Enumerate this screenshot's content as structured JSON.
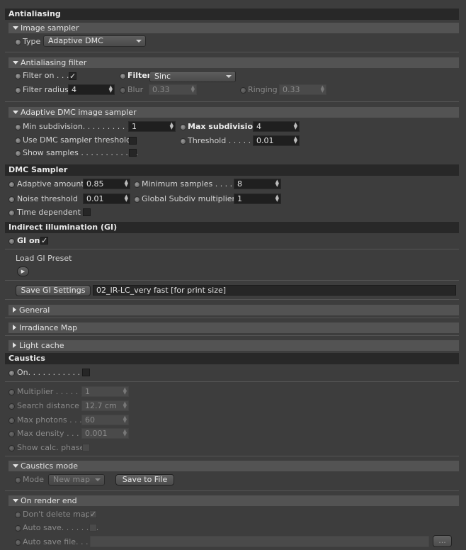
{
  "sections": {
    "antialiasing": "Antialiasing",
    "dmc_sampler": "DMC Sampler",
    "indirect_illumination": "Indirect illumination (GI)",
    "caustics": "Caustics"
  },
  "image_sampler": {
    "title": "Image sampler",
    "type_label": "Type",
    "type_value": "Adaptive DMC"
  },
  "aa_filter": {
    "title": "Antialiasing filter",
    "filter_on_label": "Filter on . . .",
    "filter_on_checked": "✓",
    "filter_label": "Filter",
    "filter_value": "Sinc",
    "filter_radius_label": "Filter radius",
    "filter_radius_value": "4",
    "blur_label": "Blur",
    "blur_value": "0.33",
    "ringing_label": "Ringing",
    "ringing_value": "0.33"
  },
  "adaptive_dmc": {
    "title": "Adaptive DMC image sampler",
    "min_subdiv_label": "Min subdivision. . . . . . . . . . .",
    "min_subdiv_value": "1",
    "max_subdiv_label": "Max subdivision",
    "max_subdiv_value": "4",
    "use_dmc_threshold_label": "Use DMC sampler threshold",
    "threshold_label": "Threshold . . . . . .",
    "threshold_value": "0.01",
    "show_samples_label": "Show samples . . . . . . . . . . . ."
  },
  "dmc": {
    "adaptive_amount_label": "Adaptive amount",
    "adaptive_amount_value": "0.85",
    "min_samples_label": "Minimum samples . . . . .",
    "min_samples_value": "8",
    "noise_threshold_label": "Noise threshold",
    "noise_threshold_value": "0.01",
    "global_subdiv_label": "Global Subdiv multiplier",
    "global_subdiv_value": "1",
    "time_dependent_label": "Time dependent"
  },
  "gi": {
    "gi_on_label": "GI on",
    "gi_on_checked": "✓",
    "load_preset_label": "Load GI Preset",
    "save_button": "Save GI Settings",
    "preset_name": "02_IR-LC_very fast [for print size]",
    "general": "General",
    "irradiance_map": "Irradiance Map",
    "light_cache": "Light cache"
  },
  "caustics": {
    "on_label": "On. . . . . . . . . . . .",
    "multiplier_label": "Multiplier . . . . . .",
    "multiplier_value": "1",
    "search_distance_label": "Search distance",
    "search_distance_value": "12.7 cm",
    "max_photons_label": "Max photons . . .",
    "max_photons_value": "60",
    "max_density_label": "Max density . . . .",
    "max_density_value": "0.001",
    "show_calc_label": "Show calc. phase",
    "mode_title": "Caustics mode",
    "mode_label": "Mode",
    "mode_value": "New map",
    "save_to_file": "Save to File",
    "render_end_title": "On render end",
    "dont_delete_label": "Don't delete map",
    "dont_delete_checked": "✓",
    "auto_save_label": "Auto save. . . . . . . .",
    "auto_save_file_label": "Auto save file. . . .",
    "browse_button": "..."
  },
  "colors": {
    "background": "#3d3d3d",
    "header": "#282828",
    "subheader": "#535353",
    "field": "#1f1f1f"
  }
}
